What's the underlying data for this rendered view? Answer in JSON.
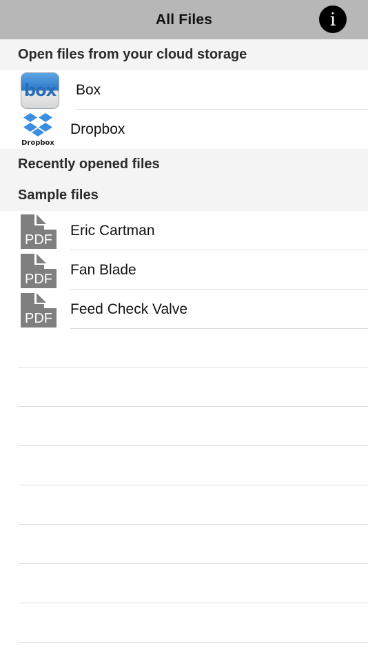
{
  "header": {
    "title": "All Files",
    "info_glyph": "i"
  },
  "sections": {
    "cloud": {
      "title": "Open files from your cloud storage",
      "items": [
        {
          "label": "Box",
          "icon": "box-logo-icon",
          "icon_text": "box"
        },
        {
          "label": "Dropbox",
          "icon": "dropbox-logo-icon",
          "icon_text": "Dropbox"
        }
      ]
    },
    "recent": {
      "title": "Recently opened files"
    },
    "samples": {
      "title": "Sample files",
      "items": [
        {
          "label": "Eric Cartman",
          "icon": "pdf-file-icon",
          "icon_text": "PDF"
        },
        {
          "label": "Fan Blade",
          "icon": "pdf-file-icon",
          "icon_text": "PDF"
        },
        {
          "label": "Feed Check Valve",
          "icon": "pdf-file-icon",
          "icon_text": "PDF"
        }
      ]
    }
  },
  "colors": {
    "nav_bar": "#b7b7b7",
    "section_header_bg": "#f4f4f4",
    "separator": "#dcdcdc",
    "pdf_icon": "#7f7f7f",
    "dropbox_blue": "#3d8ee0"
  }
}
